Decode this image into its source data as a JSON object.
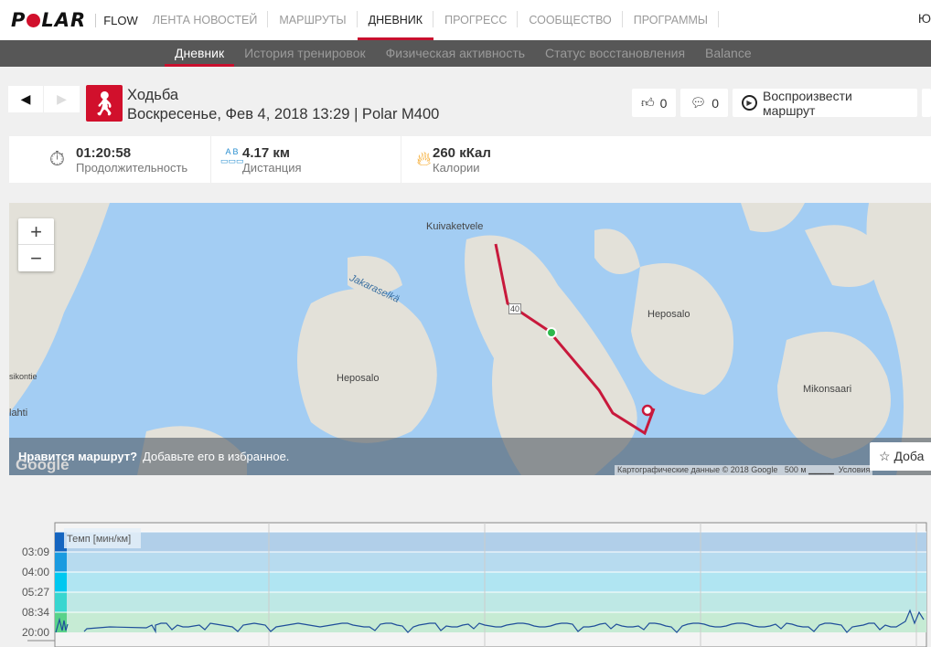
{
  "header": {
    "logo": "POLAR",
    "flow": "FLOW",
    "nav": [
      "ЛЕНТА НОВОСТЕЙ",
      "МАРШРУТЫ",
      "ДНЕВНИК",
      "ПРОГРЕСС",
      "СООБЩЕСТВО",
      "ПРОГРАММЫ"
    ],
    "active_nav": 2,
    "user": "Ю"
  },
  "subnav": {
    "items": [
      "Дневник",
      "История тренировок",
      "Физическая активность",
      "Статус восстановления",
      "Balance"
    ],
    "active": 0
  },
  "session": {
    "sport": "Ходьба",
    "details": "Воскресенье, Фев 4, 2018 13:29 | Polar M400",
    "likes": "0",
    "comments": "0",
    "replay_label": "Воспроизвести маршрут"
  },
  "stats": [
    {
      "value": "01:20:58",
      "label": "Продолжительность",
      "icon": "stopwatch-icon"
    },
    {
      "value": "4.17 км",
      "label": "Дистанция",
      "icon": "ruler-icon"
    },
    {
      "value": "260 кКал",
      "label": "Калории",
      "icon": "flame-icon"
    }
  ],
  "map": {
    "labels": [
      "Kuivaketvele",
      "Jakaraselkä",
      "Heposalo",
      "Heposalo",
      "Mikonsaari",
      "lahti",
      "sikontie",
      "40"
    ],
    "fav_question": "Нравится маршрут?",
    "fav_text": "Добавьте его в избранное.",
    "fav_button": "Доба",
    "attribution": "Картографические данные © 2018 Google",
    "scale": "500 м",
    "terms": "Условия",
    "google": "Google",
    "zoom_in": "+",
    "zoom_out": "−"
  },
  "chart_data": {
    "type": "line",
    "title": "Темп [мин/км]",
    "y_ticks": [
      "03:09",
      "04:00",
      "05:27",
      "08:34",
      "20:00"
    ],
    "colors": {
      "line": "#1f4e9a"
    }
  }
}
